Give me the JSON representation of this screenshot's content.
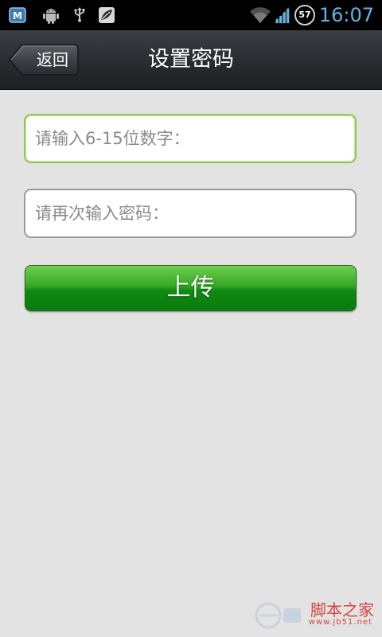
{
  "status_bar": {
    "time": "16:07",
    "battery_level": "57",
    "icons": [
      "app-m-icon",
      "android-icon",
      "usb-icon",
      "leaf-icon",
      "wifi-icon",
      "signal-icon",
      "battery-icon"
    ],
    "time_color": "#5fb6e6"
  },
  "header": {
    "back_label": "返回",
    "title": "设置密码"
  },
  "form": {
    "password_placeholder": "请输入6-15位数字：",
    "password_value": "",
    "confirm_placeholder": "请再次输入密码：",
    "confirm_value": "",
    "submit_label": "上传"
  },
  "watermark": {
    "text": "脚本之家",
    "url": "www.jb51.net"
  },
  "colors": {
    "accent_green": "#1f9a18",
    "focus_border": "#93c94a",
    "background": "#e3e3e3",
    "watermark_red": "#d7443f"
  }
}
